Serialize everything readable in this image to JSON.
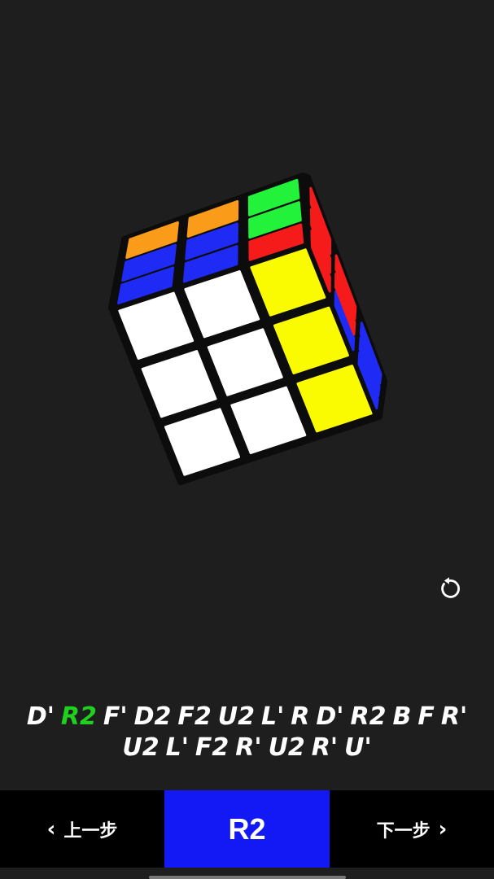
{
  "cube": {
    "colors": {
      "white": "#ffffff",
      "yellow": "#fbfb00",
      "blue": "#1f2bf5",
      "green": "#23f23a",
      "red": "#f61b1b",
      "orange": "#fa9b1a",
      "body": "#0c0c0c"
    },
    "front": [
      [
        "white",
        "white",
        "yellow"
      ],
      [
        "white",
        "white",
        "yellow"
      ],
      [
        "white",
        "white",
        "yellow"
      ]
    ],
    "top": [
      [
        "orange",
        "orange",
        "green"
      ],
      [
        "blue",
        "blue",
        "green"
      ],
      [
        "blue",
        "blue",
        "red"
      ]
    ],
    "right": [
      [
        "red",
        "red",
        "red"
      ],
      [
        "blue",
        "red",
        "red"
      ],
      [
        "blue",
        "blue",
        "blue"
      ]
    ]
  },
  "reset": {
    "icon": "rotate-ccw-icon"
  },
  "moves": {
    "line1": [
      "D'",
      "R2",
      "F'",
      "D2",
      "F2",
      "U2",
      "L'",
      "R",
      "D'",
      "R2",
      "B",
      "F",
      "R'"
    ],
    "line2": [
      "U2",
      "L'",
      "F2",
      "R'",
      "U2",
      "R'",
      "U'"
    ],
    "active_index": 1,
    "active_color": "#1fd01f"
  },
  "nav": {
    "prev_label": "上一步",
    "next_label": "下一步",
    "current_move": "R2"
  }
}
